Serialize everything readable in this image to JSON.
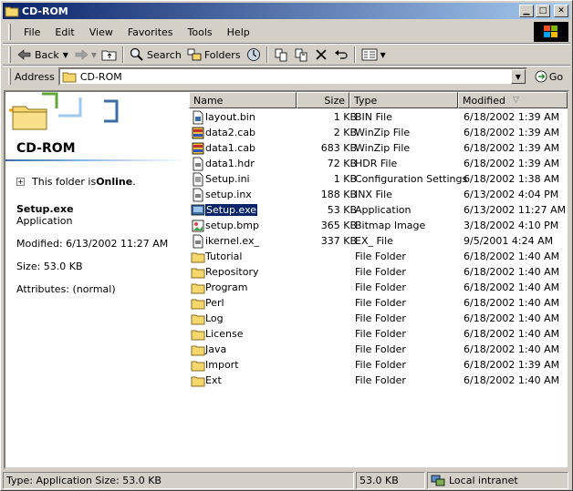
{
  "window": {
    "title": "CD-ROM"
  },
  "menu": [
    "File",
    "Edit",
    "View",
    "Favorites",
    "Tools",
    "Help"
  ],
  "toolbar": {
    "back": "Back",
    "search": "Search",
    "folders": "Folders"
  },
  "address": {
    "label": "Address",
    "value": "CD-ROM",
    "go": "Go"
  },
  "leftpane": {
    "folder_title": "CD-ROM",
    "online_prefix": "This folder is ",
    "online_bold": "Online",
    "online_suffix": ".",
    "selected_name": "Setup.exe",
    "selected_type": "Application",
    "modified": "Modified: 6/13/2002 11:27 AM",
    "size": "Size: 53.0 KB",
    "attributes": "Attributes: (normal)"
  },
  "columns": {
    "name": "Name",
    "size": "Size",
    "type": "Type",
    "modified": "Modified"
  },
  "files": [
    {
      "name": "layout.bin",
      "size": "1 KB",
      "type": "BIN File",
      "modified": "6/18/2002 1:39 AM",
      "icon": "bin-file-icon"
    },
    {
      "name": "data2.cab",
      "size": "2 KB",
      "type": "WinZip File",
      "modified": "6/18/2002 1:39 AM",
      "icon": "winzip-icon"
    },
    {
      "name": "data1.cab",
      "size": "683 KB",
      "type": "WinZip File",
      "modified": "6/18/2002 1:39 AM",
      "icon": "winzip-icon"
    },
    {
      "name": "data1.hdr",
      "size": "72 KB",
      "type": "HDR File",
      "modified": "6/18/2002 1:39 AM",
      "icon": "generic-file-icon"
    },
    {
      "name": "Setup.ini",
      "size": "1 KB",
      "type": "Configuration Settings",
      "modified": "6/18/2002 1:38 AM",
      "icon": "ini-file-icon"
    },
    {
      "name": "setup.inx",
      "size": "188 KB",
      "type": "INX File",
      "modified": "6/13/2002 4:04 PM",
      "icon": "generic-file-icon"
    },
    {
      "name": "Setup.exe",
      "size": "53 KB",
      "type": "Application",
      "modified": "6/13/2002 11:27 AM",
      "icon": "setup-exe-icon",
      "selected": true
    },
    {
      "name": "setup.bmp",
      "size": "365 KB",
      "type": "Bitmap Image",
      "modified": "3/18/2002 4:10 PM",
      "icon": "bitmap-icon"
    },
    {
      "name": "ikernel.ex_",
      "size": "337 KB",
      "type": "EX_ File",
      "modified": "9/5/2001 4:24 AM",
      "icon": "generic-file-icon"
    },
    {
      "name": "Tutorial",
      "size": "",
      "type": "File Folder",
      "modified": "6/18/2002 1:40 AM",
      "icon": "folder-icon"
    },
    {
      "name": "Repository",
      "size": "",
      "type": "File Folder",
      "modified": "6/18/2002 1:40 AM",
      "icon": "folder-icon"
    },
    {
      "name": "Program",
      "size": "",
      "type": "File Folder",
      "modified": "6/18/2002 1:40 AM",
      "icon": "folder-icon"
    },
    {
      "name": "Perl",
      "size": "",
      "type": "File Folder",
      "modified": "6/18/2002 1:40 AM",
      "icon": "folder-icon"
    },
    {
      "name": "Log",
      "size": "",
      "type": "File Folder",
      "modified": "6/18/2002 1:40 AM",
      "icon": "folder-icon"
    },
    {
      "name": "License",
      "size": "",
      "type": "File Folder",
      "modified": "6/18/2002 1:40 AM",
      "icon": "folder-icon"
    },
    {
      "name": "Java",
      "size": "",
      "type": "File Folder",
      "modified": "6/18/2002 1:40 AM",
      "icon": "folder-icon"
    },
    {
      "name": "Import",
      "size": "",
      "type": "File Folder",
      "modified": "6/18/2002 1:39 AM",
      "icon": "folder-icon"
    },
    {
      "name": "Ext",
      "size": "",
      "type": "File Folder",
      "modified": "6/18/2002 1:40 AM",
      "icon": "folder-icon"
    }
  ],
  "status": {
    "left": "Type: Application Size: 53.0 KB",
    "size": "53.0 KB",
    "zone": "Local intranet"
  }
}
